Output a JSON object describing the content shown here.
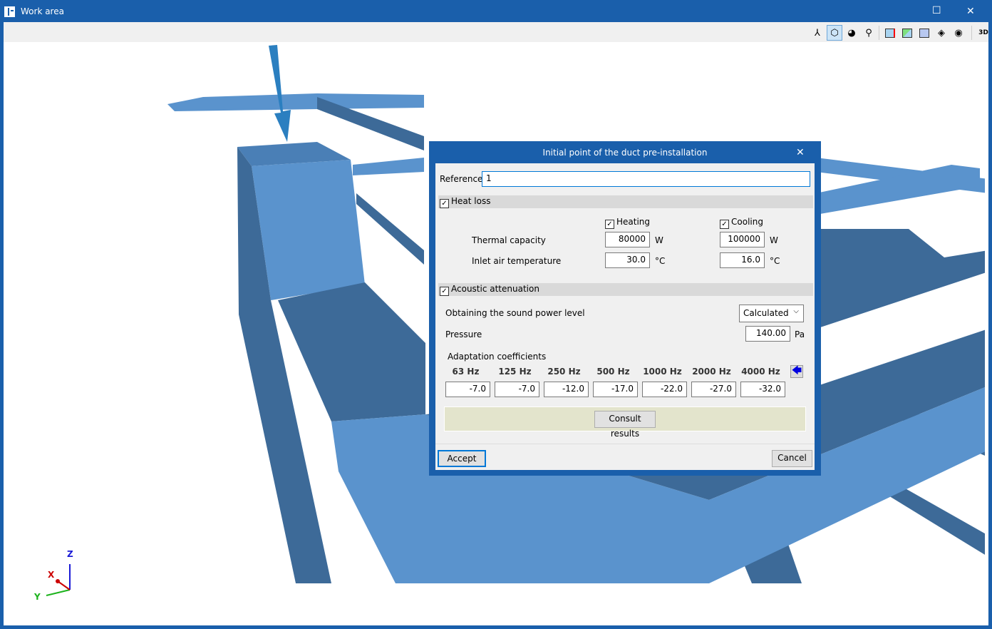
{
  "window": {
    "title": "Work area",
    "maximize": "☐",
    "close": "✕"
  },
  "toolbar": {
    "icons": [
      "axes-icon",
      "view-cube-icon",
      "orbit-icon",
      "rotate-icon",
      "section-x-icon",
      "section-diagonal-icon",
      "section-horizontal-icon",
      "layers-icon",
      "hide-icon",
      "3d-settings-icon"
    ],
    "three_d_label": "3D"
  },
  "dialog": {
    "title": "Initial point of the duct pre-installation",
    "close": "✕",
    "reference_label": "Reference",
    "reference_value": "1",
    "heat_loss": {
      "label": "Heat loss",
      "checked": true,
      "heating_label": "Heating",
      "cooling_label": "Cooling",
      "thermal_capacity_label": "Thermal capacity",
      "inlet_temp_label": "Inlet air temperature",
      "heating_capacity": "80000",
      "cooling_capacity": "100000",
      "capacity_unit": "W",
      "heating_temp": "30.0",
      "cooling_temp": "16.0",
      "temp_unit": "°C"
    },
    "acoustic": {
      "label": "Acoustic attenuation",
      "checked": true,
      "sound_power_label": "Obtaining the sound power level",
      "sound_power_value": "Calculated",
      "pressure_label": "Pressure",
      "pressure_value": "140.00",
      "pressure_unit": "Pa",
      "adaptation_label": "Adaptation coefficients",
      "bands": [
        {
          "hz": "63 Hz",
          "v": "-7.0"
        },
        {
          "hz": "125 Hz",
          "v": "-7.0"
        },
        {
          "hz": "250 Hz",
          "v": "-12.0"
        },
        {
          "hz": "500 Hz",
          "v": "-17.0"
        },
        {
          "hz": "1000 Hz",
          "v": "-22.0"
        },
        {
          "hz": "2000 Hz",
          "v": "-27.0"
        },
        {
          "hz": "4000 Hz",
          "v": "-32.0"
        }
      ],
      "consult_label": "Consult results"
    },
    "accept": "Accept",
    "cancel": "Cancel"
  },
  "axes": {
    "z": "Z",
    "x": "X",
    "y": "Y"
  },
  "colors": {
    "accent": "#1a5fab",
    "duct_light": "#5a93cd",
    "duct_dark": "#3d6a98"
  }
}
